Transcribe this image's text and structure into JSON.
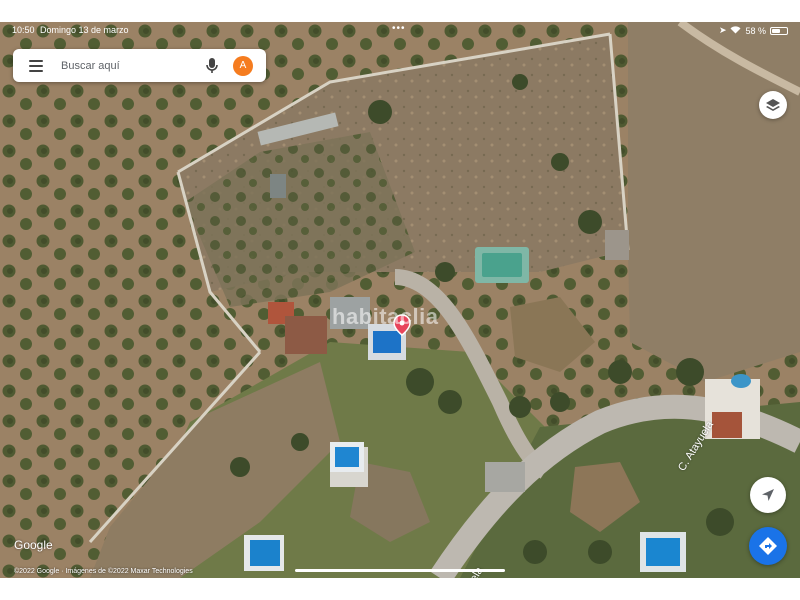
{
  "status_bar": {
    "time": "10:50",
    "date": "Domingo 13 de marzo",
    "battery": "58 %",
    "battery_level": 0.58
  },
  "search": {
    "placeholder": "Buscar aquí",
    "avatar_letter": "A",
    "avatar_color": "#f57c1f"
  },
  "map": {
    "watermark": "habitaclia",
    "street_labels": [
      "C. Atayuela",
      "yuela"
    ],
    "google_logo": "Google",
    "copyright": "©2022 Google · Imágenes de ©2022 Maxar Technologies",
    "pin_color": "#e8455c"
  },
  "controls": {
    "layers_icon": "layers-icon",
    "compass_icon": "navigation-arrow-icon",
    "directions_icon": "directions-icon",
    "directions_color": "#1a73e8"
  }
}
